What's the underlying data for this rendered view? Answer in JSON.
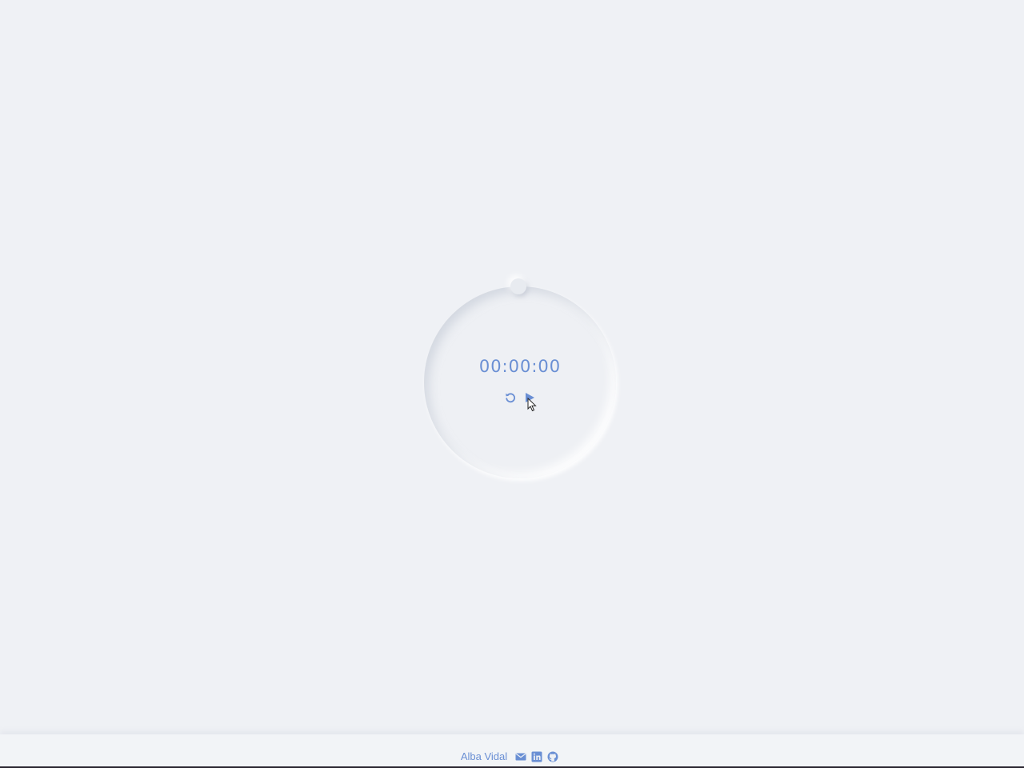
{
  "timer": {
    "display": "00:00:00",
    "progress": 0
  },
  "controls": {
    "reset_icon": "reset-icon",
    "play_icon": "play-icon"
  },
  "footer": {
    "author": "Alba Vidal",
    "icons": [
      "mail-icon",
      "linkedin-icon",
      "github-icon"
    ]
  },
  "colors": {
    "background": "#eff1f5",
    "accent": "#6a8fd4"
  }
}
